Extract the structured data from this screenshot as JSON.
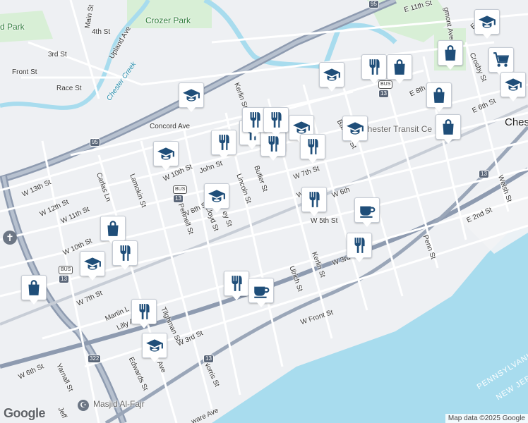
{
  "map": {
    "attribution": "Map data ©2025 Google",
    "logo": "Google",
    "city_label": "Chest",
    "parks": [
      "Crozer Park",
      "d Park"
    ],
    "water": [
      "Chester Creek"
    ],
    "states": [
      "PENNSYLVANIA",
      "NEW JER"
    ],
    "pois": [
      "Chester Transit Ce",
      "Masjid Al-Fajr"
    ],
    "shields": {
      "i95": "95",
      "us13": "13",
      "us322": "322",
      "bus": "BUS"
    },
    "streets": [
      "Main St",
      "4th St",
      "Upland Ave",
      "3rd St",
      "Front St",
      "Race St",
      "Concord Ave",
      "Kerlin St",
      "W 10th St",
      "John St",
      "Butler St",
      "Lincoln St",
      "W 8th St",
      "W 7th St",
      "W 5th St",
      "W 3rd St",
      "Barclay St",
      "W 13th St",
      "W 12th St",
      "W 11th St",
      "W 10th St",
      "Carlas Ln",
      "Lamokin St",
      "Pennell St",
      "Lloyd St",
      "ey St",
      "Ulrich St",
      "Kerlin St",
      "W Front St",
      "W 7th St",
      "Martin L",
      "Lilly A",
      "W 3rd St",
      "Tilghman St",
      "Edwards St",
      "Norris St",
      "W 6th St",
      "Yarnall St",
      "Jeff",
      "Penn St",
      "Welsh St",
      "E 2nd St",
      "E 6th St",
      "Crosby St",
      "E 8th",
      "E 11th St",
      "E 10th",
      "gmont Ave",
      "W 9th",
      "W 6th",
      "Ave",
      "ware Ave"
    ],
    "colors": {
      "land": "#eef0f3",
      "water": "#a8dcee",
      "park": "#d8efd6",
      "highway": "#8e9bb0",
      "road": "#ffffff",
      "marker_icon": "#1f4e79"
    }
  },
  "markers": [
    {
      "type": "school",
      "label": "school-marker"
    },
    {
      "type": "restaurant",
      "label": "restaurant-marker"
    },
    {
      "type": "shopping",
      "label": "shopping-marker"
    },
    {
      "type": "school",
      "label": "school-marker"
    },
    {
      "type": "school",
      "label": "school-marker"
    },
    {
      "type": "shopping-cart",
      "label": "grocery-marker"
    },
    {
      "type": "shopping",
      "label": "shopping-marker"
    },
    {
      "type": "shopping",
      "label": "shopping-marker"
    },
    {
      "type": "school",
      "label": "school-marker"
    },
    {
      "type": "shopping",
      "label": "shopping-marker"
    },
    {
      "type": "school",
      "label": "school-marker"
    },
    {
      "type": "restaurant",
      "label": "restaurant-marker"
    },
    {
      "type": "restaurant",
      "label": "restaurant-marker"
    },
    {
      "type": "restaurant",
      "label": "restaurant-marker"
    },
    {
      "type": "restaurant",
      "label": "restaurant-marker"
    },
    {
      "type": "school",
      "label": "school-marker"
    },
    {
      "type": "restaurant",
      "label": "restaurant-marker"
    },
    {
      "type": "restaurant",
      "label": "restaurant-marker"
    },
    {
      "type": "school",
      "label": "school-marker"
    },
    {
      "type": "restaurant",
      "label": "restaurant-marker"
    },
    {
      "type": "school",
      "label": "school-marker"
    },
    {
      "type": "restaurant",
      "label": "restaurant-marker"
    },
    {
      "type": "shopping",
      "label": "shopping-marker"
    },
    {
      "type": "cafe",
      "label": "cafe-marker"
    },
    {
      "type": "restaurant",
      "label": "restaurant-marker"
    },
    {
      "type": "school",
      "label": "school-marker"
    },
    {
      "type": "restaurant",
      "label": "restaurant-marker"
    },
    {
      "type": "shopping",
      "label": "shopping-marker"
    },
    {
      "type": "restaurant",
      "label": "restaurant-marker"
    },
    {
      "type": "cafe",
      "label": "cafe-marker"
    },
    {
      "type": "restaurant",
      "label": "restaurant-marker"
    },
    {
      "type": "school",
      "label": "school-marker"
    }
  ]
}
